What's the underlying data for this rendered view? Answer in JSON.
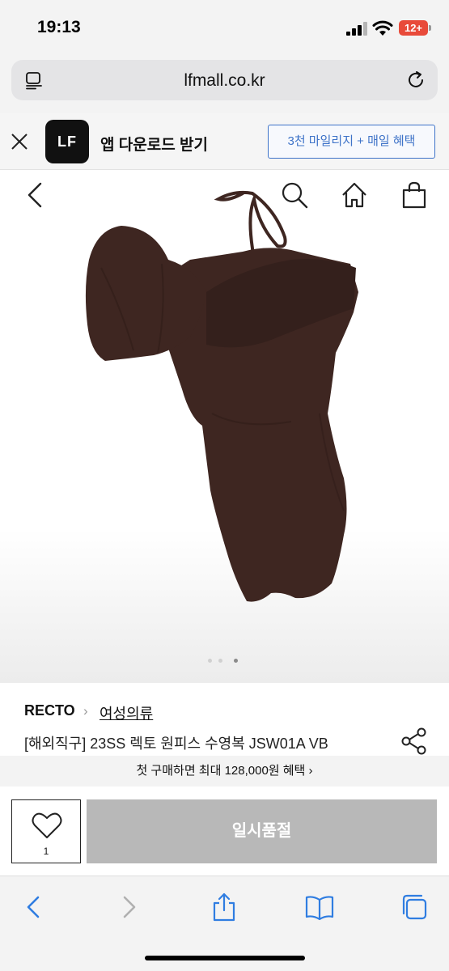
{
  "status_bar": {
    "time": "19:13",
    "battery": "12+"
  },
  "browser": {
    "url": "lfmall.co.kr"
  },
  "app_banner": {
    "logo_text": "LF",
    "text": "앱 다운로드 받기",
    "button": "3천 마일리지 + 매일 혜택"
  },
  "icons": {
    "url_left": "reader-icon",
    "reload": "reload-icon",
    "close": "close-icon",
    "back": "back-icon",
    "search": "search-icon",
    "home": "home-icon",
    "cart": "shopping-bag-icon",
    "share": "share-icon",
    "heart": "heart-icon",
    "toolbar": [
      "back-arrow-icon",
      "forward-arrow-icon",
      "share-icon",
      "bookmarks-icon",
      "tabs-icon"
    ]
  },
  "gallery": {
    "image": "brown one-shoulder swimsuit",
    "dot_count": 3,
    "active_dot": 2
  },
  "product": {
    "brand": "RECTO",
    "category": "여성의류",
    "name": "[해외직구] 23SS 렉토 원피스 수영복 JSW01A VB",
    "benefit": "첫 구매하면 최대 128,000원 혜택 ›"
  },
  "buy_bar": {
    "like_count": "1",
    "button": "일시품절"
  },
  "colors": {
    "accent_blue": "#3e73c8",
    "swimsuit": "#3e2621",
    "soldout_gray": "#b8b8b8",
    "ios_blue": "#2f7de1"
  }
}
